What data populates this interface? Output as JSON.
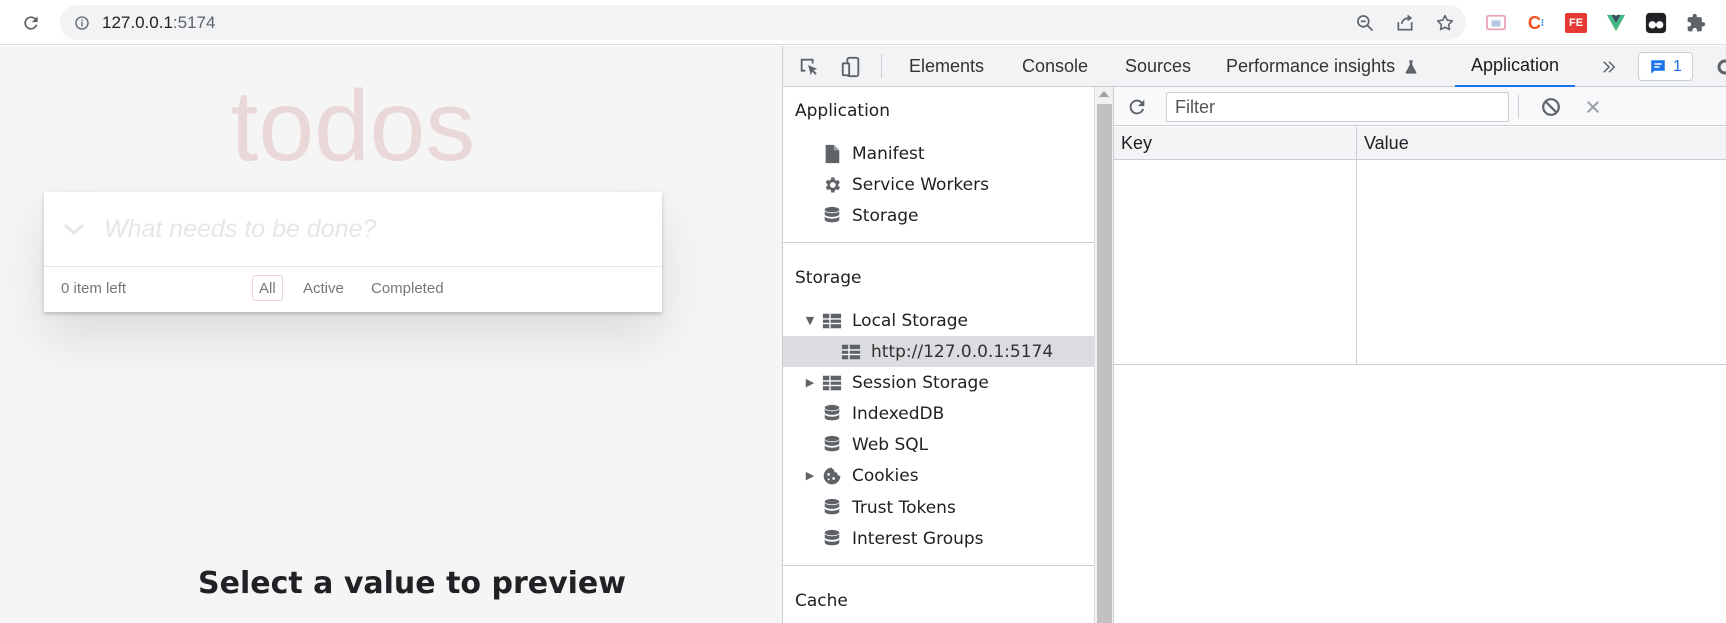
{
  "browser": {
    "url_host": "127.0.0.1",
    "url_port": ":5174",
    "extensions": [
      {
        "name": "reading-list-extension-icon",
        "label": "",
        "color": "#e8a3b6"
      },
      {
        "name": "c-extension-icon",
        "label": "C",
        "color": "#f4511e"
      },
      {
        "name": "fe-extension-icon",
        "label": "FE",
        "color": "#e53935"
      },
      {
        "name": "vue-devtools-icon",
        "label": "",
        "color": "#41b883"
      },
      {
        "name": "tampermonkey-icon",
        "label": "",
        "color": "#202124"
      },
      {
        "name": "extensions-puzzle-icon",
        "label": "",
        "color": "#5f6368"
      }
    ]
  },
  "todo_app": {
    "title": "todos",
    "input_placeholder": "What needs to be done?",
    "count_text": "0 item left",
    "filters": [
      "All",
      "Active",
      "Completed"
    ],
    "selected_filter": "All"
  },
  "devtools": {
    "tabs": [
      "Elements",
      "Console",
      "Sources",
      "Performance insights",
      "Application"
    ],
    "active_tab": "Application",
    "issues_count": "1",
    "sidebar": {
      "application_section": {
        "title": "Application",
        "items": [
          {
            "label": "Manifest",
            "icon": "file-icon"
          },
          {
            "label": "Service Workers",
            "icon": "gear-icon"
          },
          {
            "label": "Storage",
            "icon": "database-icon"
          }
        ]
      },
      "storage_section": {
        "title": "Storage",
        "items": [
          {
            "label": "Local Storage",
            "icon": "table-icon",
            "expander": "expanded"
          },
          {
            "label": "http://127.0.0.1:5174",
            "icon": "table-icon",
            "selected": true
          },
          {
            "label": "Session Storage",
            "icon": "table-icon",
            "expander": "collapsed"
          },
          {
            "label": "IndexedDB",
            "icon": "database-icon"
          },
          {
            "label": "Web SQL",
            "icon": "database-icon"
          },
          {
            "label": "Cookies",
            "icon": "cookie-icon",
            "expander": "collapsed"
          },
          {
            "label": "Trust Tokens",
            "icon": "database-icon"
          },
          {
            "label": "Interest Groups",
            "icon": "database-icon"
          }
        ]
      },
      "cache_section": {
        "title": "Cache"
      }
    },
    "storage_view": {
      "filter_placeholder": "Filter",
      "columns": [
        "Key",
        "Value"
      ],
      "placeholder_text": "Select a value to preview"
    }
  }
}
